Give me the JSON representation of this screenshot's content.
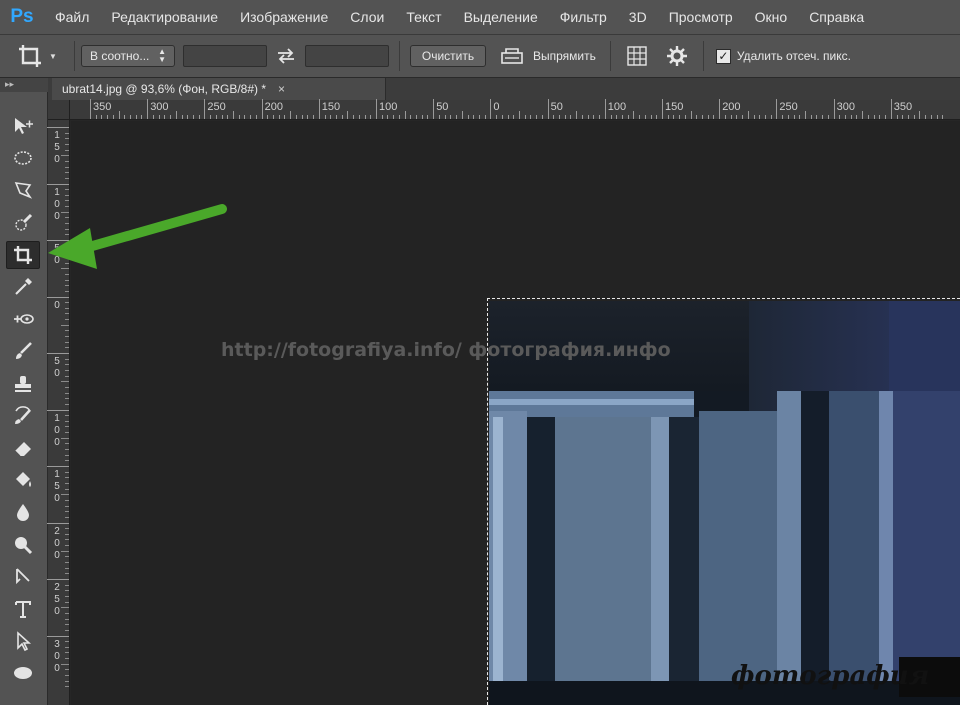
{
  "app": {
    "logo_text": "Ps"
  },
  "menu": [
    "Файл",
    "Редактирование",
    "Изображение",
    "Слои",
    "Текст",
    "Выделение",
    "Фильтр",
    "3D",
    "Просмотр",
    "Окно",
    "Справка"
  ],
  "options_bar": {
    "ratio_select": "В соотно...",
    "clear_button": "Очистить",
    "straighten_label": "Выпрямить",
    "delete_cropped_label": "Удалить отсеч. пикс.",
    "delete_cropped_checked": true
  },
  "document_tab": {
    "title": "ubrat14.jpg @ 93,6% (Фон, RGB/8#) *",
    "close_glyph": "×"
  },
  "rulers": {
    "horizontal_labels": [
      "350",
      "300",
      "250",
      "200",
      "150",
      "100",
      "50",
      "0",
      "50",
      "100",
      "150",
      "200",
      "250",
      "300",
      "350"
    ],
    "vertical_labels": [
      "150",
      "100",
      "50",
      "0",
      "50",
      "100",
      "150",
      "200",
      "250",
      "300"
    ]
  },
  "tools": [
    {
      "name": "move-tool-icon"
    },
    {
      "name": "elliptical-marquee-tool-icon"
    },
    {
      "name": "lasso-tool-icon"
    },
    {
      "name": "quick-selection-tool-icon"
    },
    {
      "name": "crop-tool-icon",
      "active": true
    },
    {
      "name": "eyedropper-tool-icon"
    },
    {
      "name": "spot-healing-brush-icon"
    },
    {
      "name": "brush-tool-icon"
    },
    {
      "name": "clone-stamp-tool-icon"
    },
    {
      "name": "history-brush-icon"
    },
    {
      "name": "eraser-tool-icon"
    },
    {
      "name": "paint-bucket-icon"
    },
    {
      "name": "blur-tool-icon"
    },
    {
      "name": "dodge-tool-icon"
    },
    {
      "name": "pen-tool-icon"
    },
    {
      "name": "type-tool-icon"
    },
    {
      "name": "path-selection-icon"
    },
    {
      "name": "ellipse-shape-icon"
    }
  ],
  "canvas": {
    "watermark": "http://fotografiya.info/  фотография.инфо",
    "photo_logo": "фотография"
  },
  "colors": {
    "arrow": "#4aa82a",
    "panel": "#535353",
    "canvas": "#232323"
  }
}
